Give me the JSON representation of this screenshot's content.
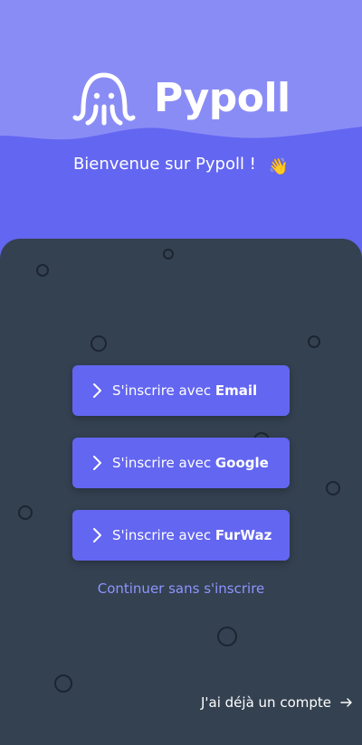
{
  "brand": {
    "name": "Pypoll",
    "logo_icon": "octopus-logo-icon"
  },
  "welcome": {
    "text": "Bienvenue sur Pypoll !",
    "emoji": "👋"
  },
  "buttons": [
    {
      "prefix": "S'inscrire avec ",
      "provider": "Email",
      "icon": "chevron-right-icon"
    },
    {
      "prefix": "S'inscrire avec ",
      "provider": "Google",
      "icon": "chevron-right-icon"
    },
    {
      "prefix": "S'inscrire avec ",
      "provider": "FurWaz",
      "icon": "chevron-right-icon"
    }
  ],
  "continue_label": "Continuer sans s'inscrire",
  "login_label": "J'ai déjà un compte",
  "login_icon": "arrow-right-icon",
  "colors": {
    "header_top": "#8a8cf6",
    "header_bottom": "#6366f0",
    "panel": "#344151",
    "accent": "#6366f0",
    "link": "#8e95ff"
  }
}
